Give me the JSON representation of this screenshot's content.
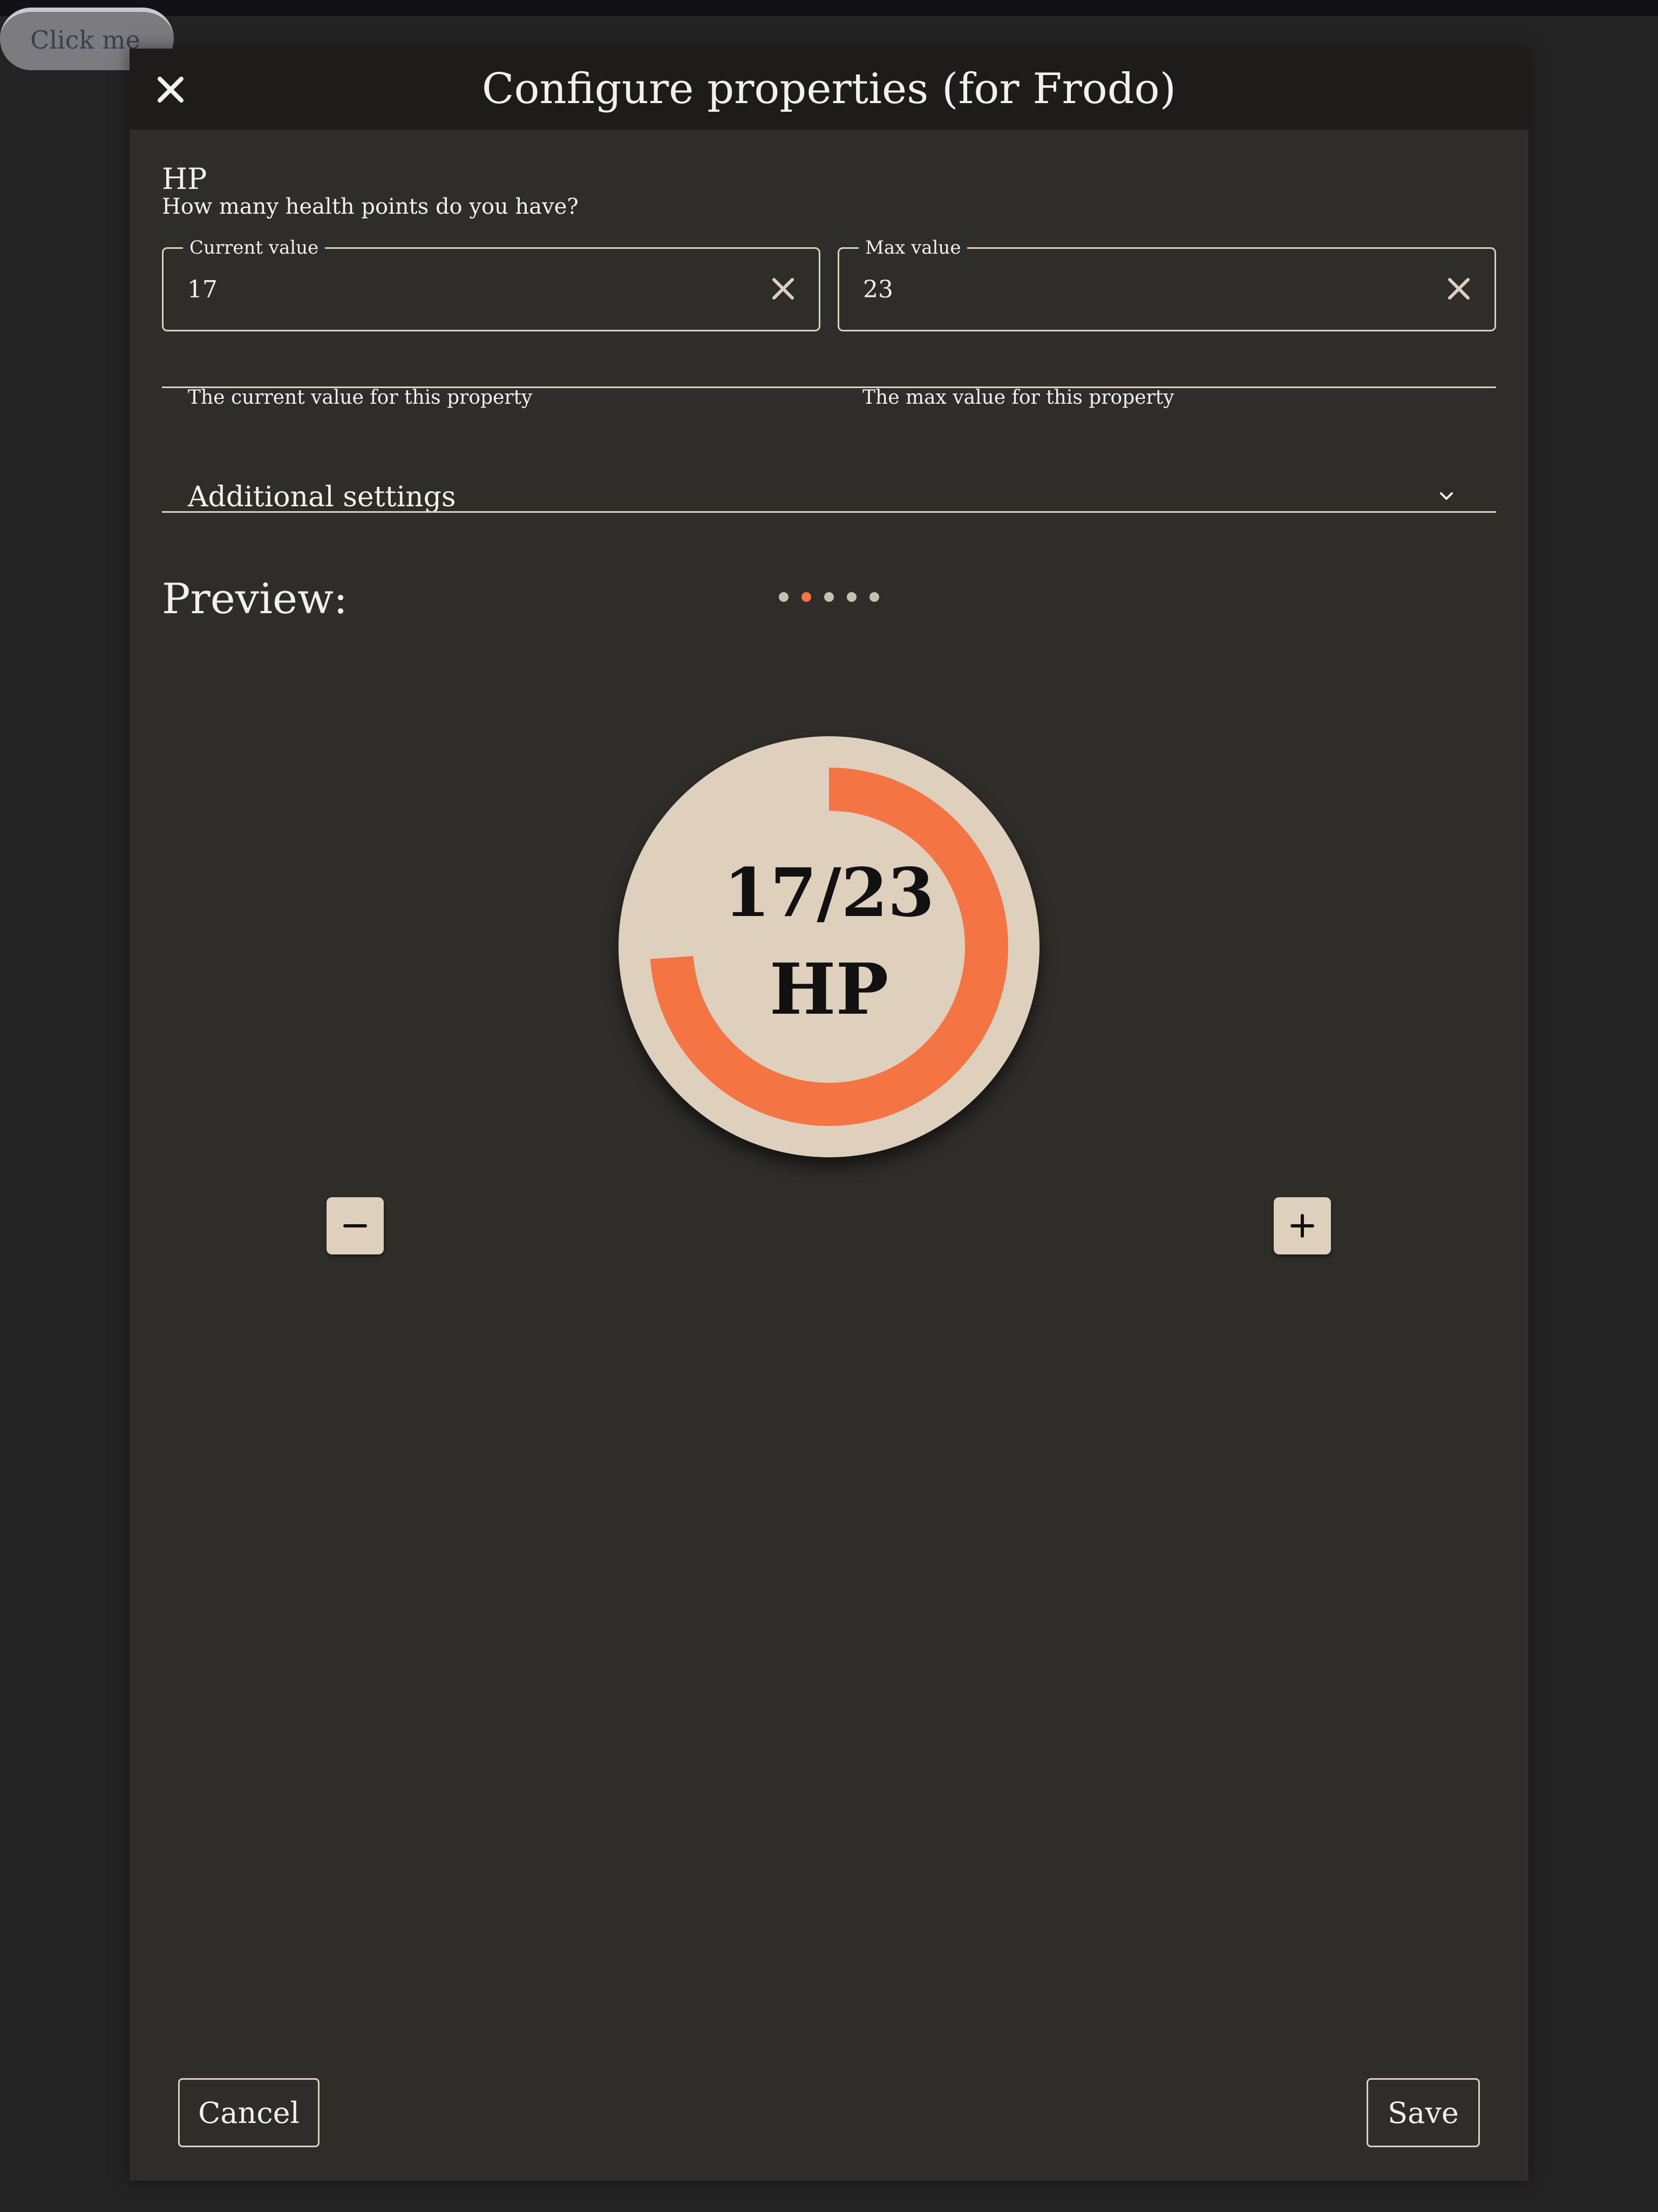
{
  "background_button": {
    "label": "Click me"
  },
  "dialog": {
    "title": "Configure properties (for Frodo)",
    "close_icon": "close-icon"
  },
  "property": {
    "name": "HP",
    "description": "How many health points do you have?"
  },
  "fields": {
    "current": {
      "legend": "Current value",
      "value": "17",
      "helper": "The current value for this property"
    },
    "max": {
      "legend": "Max value",
      "value": "23",
      "helper": "The max value for this property"
    }
  },
  "accordion": {
    "label": "Additional settings",
    "icon": "chevron-down-icon"
  },
  "preview": {
    "label": "Preview:",
    "carousel": {
      "total": 5,
      "active_index": 1
    },
    "gauge": {
      "current": 17,
      "max": 23,
      "value_text": "17/23",
      "unit": "HP",
      "fill_fraction": 0.739
    },
    "decrement_icon": "minus-icon",
    "increment_icon": "plus-icon"
  },
  "footer": {
    "cancel_label": "Cancel",
    "save_label": "Save"
  },
  "colors": {
    "accent": "#f47444",
    "surface": "#2e2d2a",
    "header": "#1d1c1a",
    "gauge_bg": "#ded0bd",
    "text": "#f4f1ec"
  }
}
